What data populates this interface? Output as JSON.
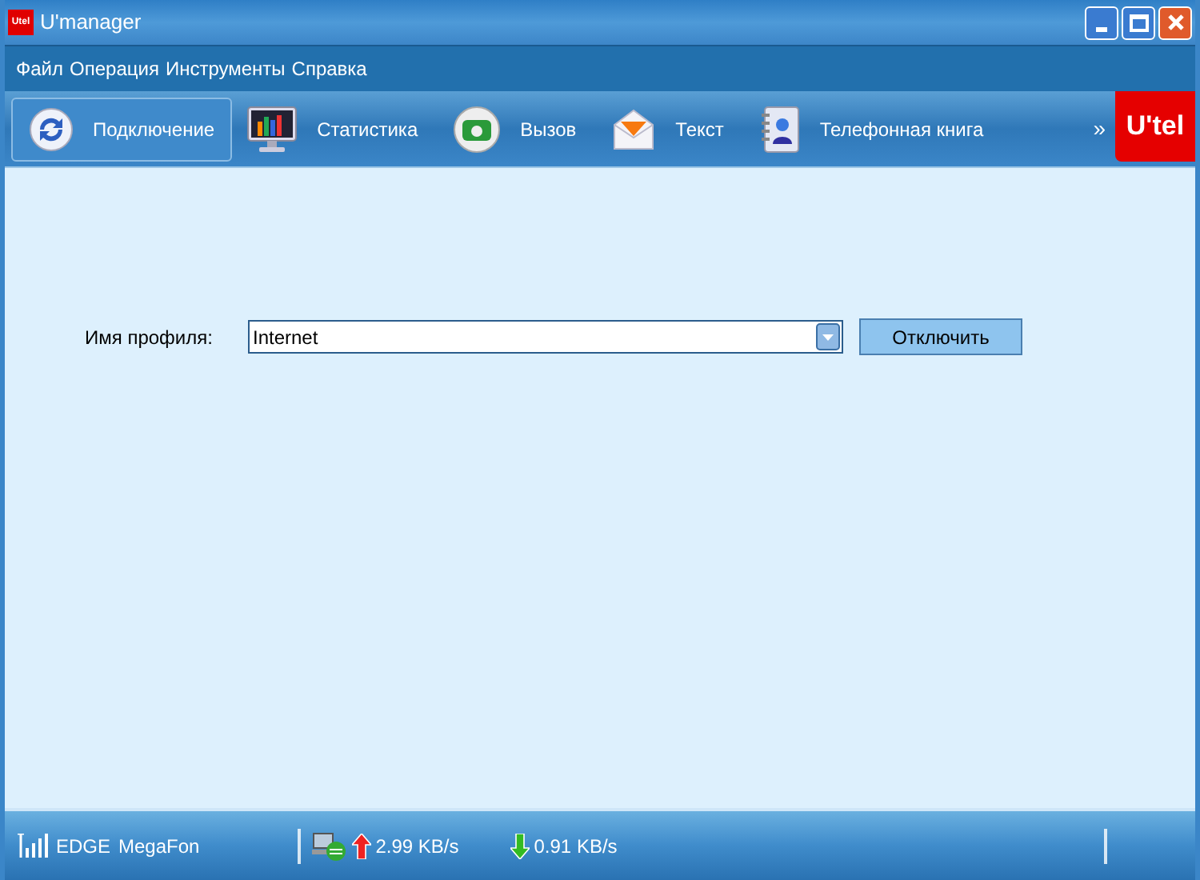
{
  "window": {
    "title": "U'manager",
    "logo": "Utel"
  },
  "menu": [
    "Файл",
    "Операция",
    "Инструменты",
    "Справка"
  ],
  "toolbar": [
    {
      "label": "Подключение",
      "kind": "connect",
      "selected": true
    },
    {
      "label": "Статистика",
      "kind": "stats",
      "selected": false
    },
    {
      "label": "Вызов",
      "kind": "call",
      "selected": false
    },
    {
      "label": "Текст",
      "kind": "text",
      "selected": false
    },
    {
      "label": "Телефонная книга",
      "kind": "book",
      "selected": false
    }
  ],
  "more": "»",
  "brand": "U'tel",
  "profile": {
    "label": "Имя профиля:",
    "value": "Internet",
    "button": "Отключить"
  },
  "status_bar": {
    "network": "EDGE",
    "operator": "MegaFon",
    "upload": "2.99 KB/s",
    "download": "0.91 KB/s"
  }
}
